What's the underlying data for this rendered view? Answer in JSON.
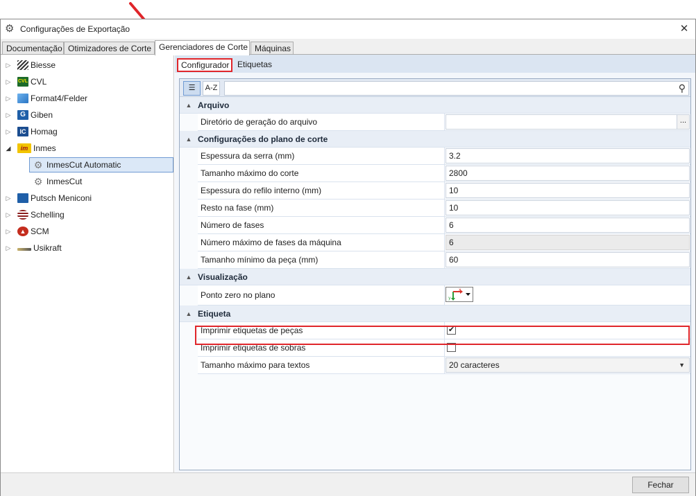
{
  "window": {
    "title": "Configurações de Exportação",
    "close_glyph": "✕"
  },
  "tabs": [
    {
      "label": "Documentação"
    },
    {
      "label": "Otimizadores de Corte"
    },
    {
      "label": "Gerenciadores de Corte",
      "active": true
    },
    {
      "label": "Máquinas"
    }
  ],
  "tree": {
    "items": [
      {
        "label": "Biesse",
        "logo": "biesse-logo",
        "color": "#3a3a3a"
      },
      {
        "label": "CVL",
        "logo": "cvl-logo",
        "color": "#1c6b2a"
      },
      {
        "label": "Format4/Felder",
        "logo": "format4-logo",
        "color": "#2a76c4"
      },
      {
        "label": "Giben",
        "logo": "giben-logo",
        "color": "#1f5fa8"
      },
      {
        "label": "Homag",
        "logo": "homag-logo",
        "color": "#1b4d90"
      },
      {
        "label": "Inmes",
        "logo": "inmes-logo",
        "color": "#d4a100",
        "expanded": true
      },
      {
        "label": "Putsch Meniconi",
        "logo": "putsch-logo",
        "color": "#1f5fa8"
      },
      {
        "label": "Schelling",
        "logo": "schelling-logo",
        "color": "#8a1c1c"
      },
      {
        "label": "SCM",
        "logo": "scm-logo",
        "color": "#c42d1e"
      },
      {
        "label": "Usikraft",
        "logo": "usikraft-logo",
        "color": "#777777"
      }
    ],
    "children": [
      {
        "label": "InmesCut Automatic",
        "selected": true
      },
      {
        "label": "InmesCut"
      }
    ]
  },
  "subtabs": [
    {
      "label": "Configurador",
      "active": true
    },
    {
      "label": "Etiquetas"
    }
  ],
  "toolbar": {
    "categorized_label": "☰",
    "alpha_label": "A-Z",
    "search_placeholder": ""
  },
  "grid": {
    "categories": {
      "arquivo": "Arquivo",
      "plano": "Configurações do plano de corte",
      "visualizacao": "Visualização",
      "etiqueta": "Etiqueta"
    },
    "arquivo": {
      "dir_label": "Diretório de geração do arquivo",
      "dir_value": "",
      "browse_label": "..."
    },
    "plano": {
      "espessura_serra_label": "Espessura da serra (mm)",
      "espessura_serra_value": "3.2",
      "tamanho_max_label": "Tamanho máximo do corte",
      "tamanho_max_value": "2800",
      "refilo_label": "Espessura do refilo interno (mm)",
      "refilo_value": "10",
      "resto_label": "Resto na fase (mm)",
      "resto_value": "10",
      "num_fases_label": "Número de fases",
      "num_fases_value": "6",
      "num_max_fases_label": "Número máximo de fases da máquina",
      "num_max_fases_value": "6",
      "tamanho_min_label": "Tamanho mínimo da peça (mm)",
      "tamanho_min_value": "60"
    },
    "visualizacao": {
      "ponto_zero_label": "Ponto zero no plano",
      "axis_x": "x",
      "axis_y": "y"
    },
    "etiqueta": {
      "imprimir_pecas_label": "Imprimir etiquetas de peças",
      "imprimir_pecas_checked": true,
      "imprimir_sobras_label": "Imprimir etiquetas de sobras",
      "imprimir_sobras_checked": false,
      "tamanho_textos_label": "Tamanho máximo para textos",
      "tamanho_textos_value": "20 caracteres"
    }
  },
  "footer": {
    "close_label": "Fechar"
  },
  "colors": {
    "highlight": "#e0252a",
    "accent": "#6f9ad3"
  }
}
